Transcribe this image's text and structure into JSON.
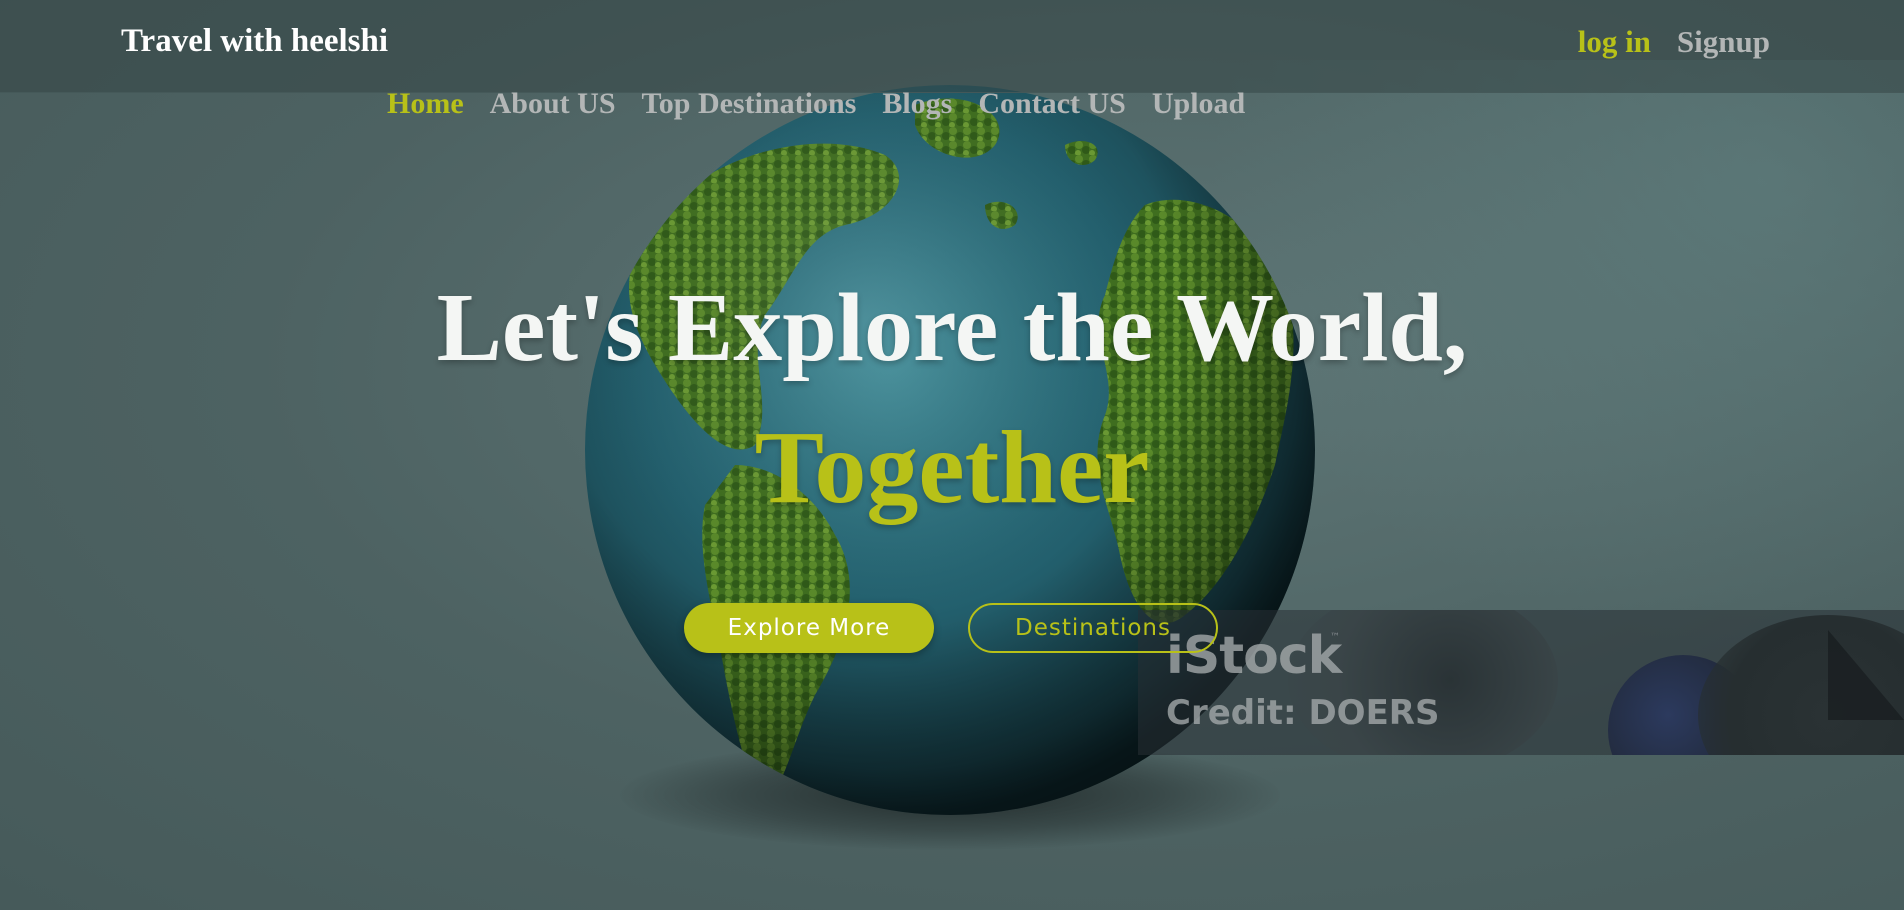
{
  "header": {
    "brand": "Travel with heelshi",
    "login_label": "log in",
    "signup_label": "Signup"
  },
  "nav": {
    "items": [
      {
        "label": "Home",
        "active": true
      },
      {
        "label": "About US",
        "active": false
      },
      {
        "label": "Top Destinations",
        "active": false
      },
      {
        "label": "Blogs",
        "active": false
      },
      {
        "label": "Contact US",
        "active": false
      },
      {
        "label": "Upload",
        "active": false
      }
    ]
  },
  "hero": {
    "title": "Let's Explore the World,",
    "title_accent": "Together",
    "primary_button": "Explore More",
    "secondary_button": "Destinations",
    "background_image": "earth-globe-covered-in-forest"
  },
  "watermark": {
    "logo": "iStock",
    "trademark": "™",
    "credit": "Credit: DOERS"
  },
  "colors": {
    "accent": "#b8c118",
    "nav_text": "#b3b6b6",
    "title_text": "#f4f6f4",
    "background": "#4d6262"
  }
}
